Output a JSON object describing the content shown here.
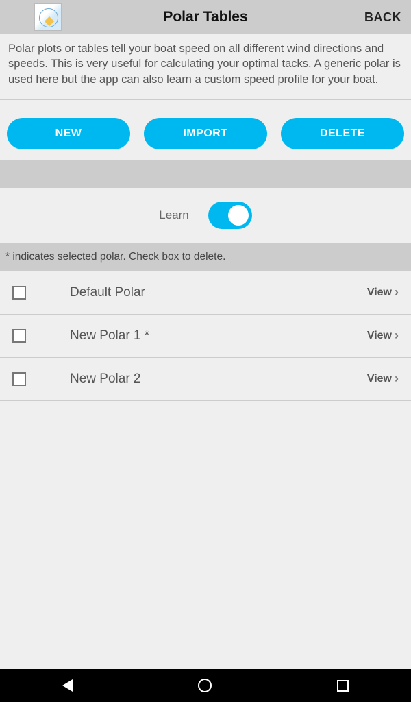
{
  "header": {
    "title": "Polar Tables",
    "back": "BACK"
  },
  "description": "Polar plots or tables tell your boat speed on all different wind directions and speeds. This is very useful for calculating your optimal tacks. A generic polar is used here but the app can also learn a custom speed profile for your boat.",
  "buttons": {
    "new": "NEW",
    "import": "IMPORT",
    "delete": "DELETE"
  },
  "learn_label": "Learn",
  "hint": "* indicates selected polar. Check box to delete.",
  "items": [
    {
      "name": "Default Polar",
      "view": "View"
    },
    {
      "name": "New Polar 1 *",
      "view": "View"
    },
    {
      "name": "New Polar 2",
      "view": "View"
    }
  ]
}
